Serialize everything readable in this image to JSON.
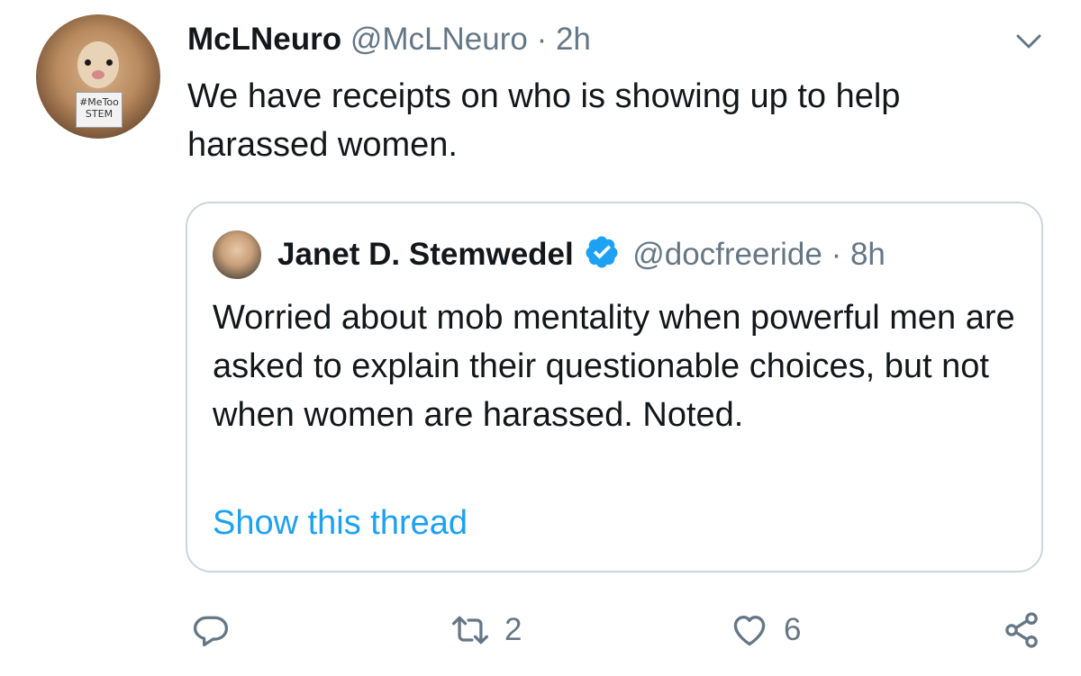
{
  "tweet": {
    "display_name": "McLNeuro",
    "handle": "@McLNeuro",
    "separator": "·",
    "time": "2h",
    "text": "We have receipts on who is showing up to help harassed women.",
    "avatar_tag_line1": "#MeToo",
    "avatar_tag_line2": "STEM"
  },
  "quoted_tweet": {
    "display_name": "Janet D. Stemwedel",
    "verified": true,
    "handle": "@docfreeride",
    "separator": "·",
    "time": "8h",
    "text": "Worried about mob mentality when powerful men are asked to explain their questionable choices, but not when women are harassed. Noted.",
    "show_thread_label": "Show this thread"
  },
  "actions": {
    "reply_icon": "reply-icon",
    "retweet_icon": "retweet-icon",
    "retweet_count": "2",
    "like_icon": "heart-icon",
    "like_count": "6",
    "share_icon": "share-icon"
  },
  "colors": {
    "accent": "#1da1f2",
    "muted": "#657786",
    "border": "#ccd6dd",
    "text": "#14171a"
  }
}
